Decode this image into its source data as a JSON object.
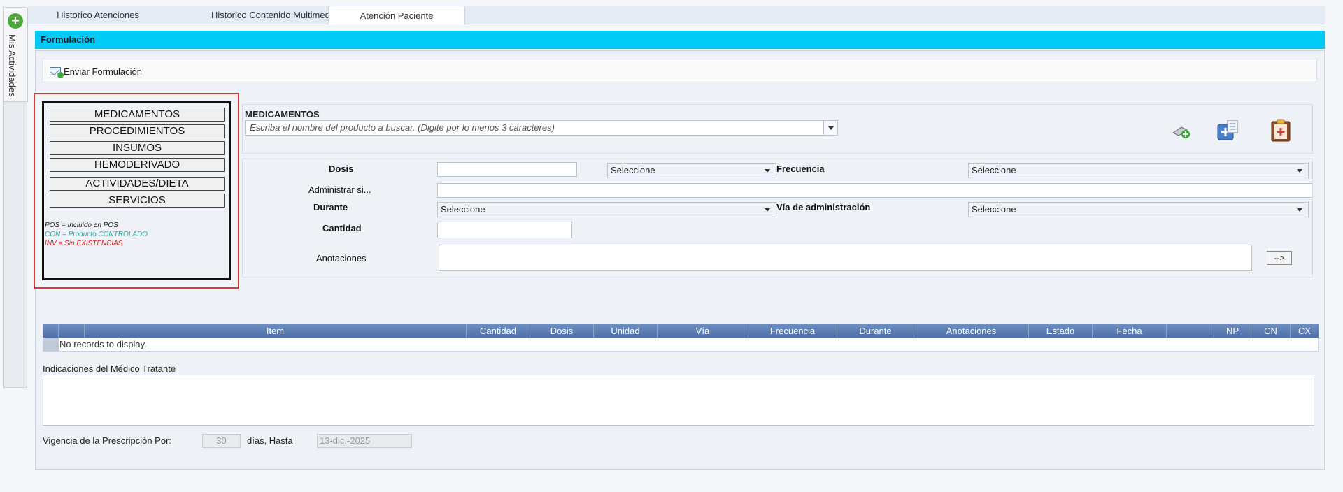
{
  "side": {
    "label": "Mis Actividades"
  },
  "tabs": [
    {
      "label": "Historico Atenciones"
    },
    {
      "label": "Historico Contenido Multimedia"
    },
    {
      "label": "Atención Paciente"
    }
  ],
  "section": {
    "title": "Formulación"
  },
  "toolbar": {
    "send_label": "Enviar Formulación"
  },
  "categories": {
    "buttons": [
      "MEDICAMENTOS",
      "PROCEDIMIENTOS",
      "INSUMOS",
      "HEMODERIVADO",
      "ACTIVIDADES/DIETA",
      "SERVICIOS"
    ],
    "legend": [
      {
        "text": "POS = Incluido en POS",
        "color": "#222222"
      },
      {
        "text": "CON = Producto CONTROLADO",
        "color": "#2aa89a"
      },
      {
        "text": "INV = Sin EXISTENCIAS",
        "color": "#e02020"
      }
    ]
  },
  "search": {
    "title": "MEDICAMENTOS",
    "placeholder": "Escriba el nombre del producto a buscar. (Digite por lo menos 3 caracteres)"
  },
  "form": {
    "dosis_label": "Dosis",
    "dosis_select": "Seleccione",
    "frecuencia_label": "Frecuencia",
    "frecuencia_select": "Seleccione",
    "administrar_label": "Administrar si...",
    "durante_label": "Durante",
    "durante_select": "Seleccione",
    "via_label": "Vía de administración",
    "via_select": "Seleccione",
    "cantidad_label": "Cantidad",
    "anotaciones_label": "Anotaciones",
    "add_button": "-->"
  },
  "grid": {
    "columns": [
      "Item",
      "Cantidad",
      "Dosis",
      "Unidad",
      "Vía",
      "Frecuencia",
      "Durante",
      "Anotaciones",
      "Estado",
      "Fecha",
      "NP",
      "CN",
      "CX"
    ],
    "empty_message": "No records to display."
  },
  "indications": {
    "label": "Indicaciones del Médico Tratante"
  },
  "validity": {
    "label": "Vigencia de la Prescripción Por:",
    "days": "30",
    "middle": "días, Hasta",
    "until": "13-dic.-2025"
  },
  "colors": {
    "header": "#00cbf5",
    "grid_header": "#5a7cb3",
    "highlight_border": "#d23a3a"
  }
}
